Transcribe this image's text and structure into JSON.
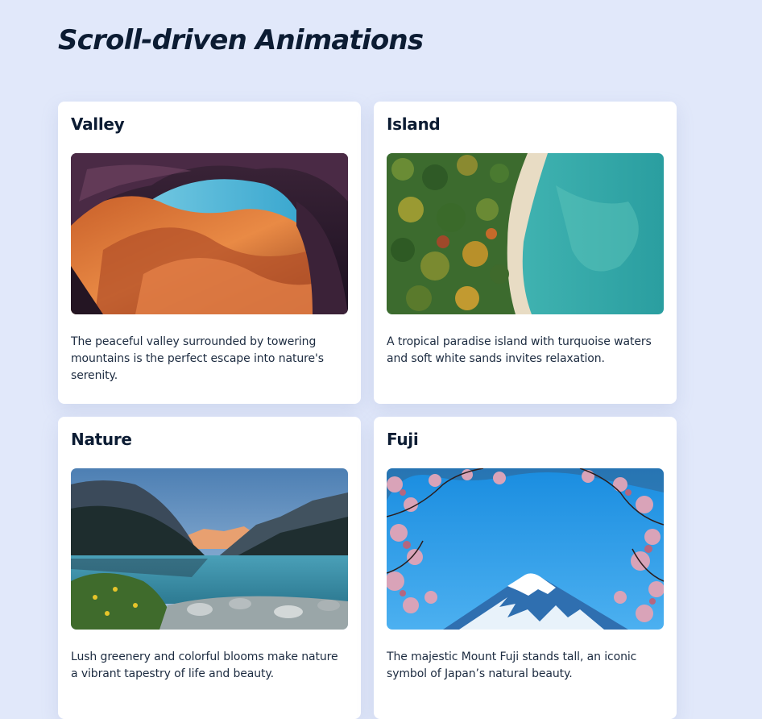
{
  "page": {
    "title": "Scroll-driven Animations",
    "background": "#e1e8fa"
  },
  "cards": [
    {
      "title": "Valley",
      "image_alt": "canyon-photo",
      "description": "The peaceful valley surrounded by towering mountains is the perfect escape into nature's serenity."
    },
    {
      "title": "Island",
      "image_alt": "island-aerial-photo",
      "description": "A tropical paradise island with turquoise waters and soft white sands invites relaxation."
    },
    {
      "title": "Nature",
      "image_alt": "mountain-lake-photo",
      "description": "Lush greenery and colorful blooms make nature a vibrant tapestry of life and beauty."
    },
    {
      "title": "Fuji",
      "image_alt": "mount-fuji-photo",
      "description": "The majestic Mount Fuji stands tall, an iconic symbol of Japan’s natural beauty."
    }
  ]
}
